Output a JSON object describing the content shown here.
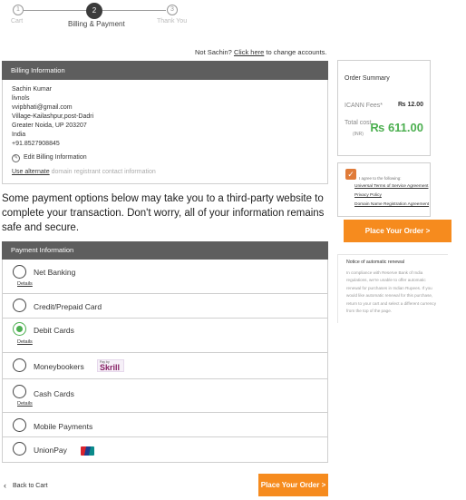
{
  "steps": [
    {
      "number": "1",
      "label": "Cart"
    },
    {
      "number": "2",
      "label": "Billing & Payment"
    },
    {
      "number": "3",
      "label": "Thank You"
    }
  ],
  "account_note": {
    "prefix": "Not Sachin?",
    "link": "Click here",
    "suffix": "to change accounts."
  },
  "billing": {
    "header": "Billing Information",
    "lines": [
      "Sachin Kumar",
      "livnols",
      "vvipbhati@gmail.com",
      "Village-Kailashpur,post-Dadri",
      "Greater Noida, UP  203207",
      "India",
      "+91.8527908845"
    ],
    "edit_label": "Edit Billing Information",
    "use_alternate": "Use alternate",
    "alternate_rest": "domain registrant contact information"
  },
  "payment_note": "Some payment options below may take you to a third-party website to complete your transaction. Don't worry, all of your information remains safe and secure.",
  "payment": {
    "header": "Payment Information",
    "details_label": "Details",
    "skrill_small": "Pay by",
    "skrill_brand": "Skrill",
    "options": [
      {
        "label": "Net Banking",
        "selected": false,
        "details": true
      },
      {
        "label": "Credit/Prepaid Card",
        "selected": false,
        "details": false
      },
      {
        "label": "Debit Cards",
        "selected": true,
        "details": true
      },
      {
        "label": "Moneybookers",
        "selected": false,
        "details": false
      },
      {
        "label": "Cash Cards",
        "selected": false,
        "details": true
      },
      {
        "label": "Mobile Payments",
        "selected": false,
        "details": false
      },
      {
        "label": "UnionPay",
        "selected": false,
        "details": false
      }
    ]
  },
  "footer": {
    "back_label": "Back to Cart",
    "back_icon": "chevron-left-icon",
    "place_order": "Place Your Order >"
  },
  "summary": {
    "title": "Order Summary",
    "icann_label": "ICANN Fees*",
    "icann_value": "₨ 12.00",
    "total_label": "Total cost",
    "total_sub": "(INR)",
    "total_value": "₨ 611.00"
  },
  "agreement": {
    "checked": true,
    "text": "I agree to the following:",
    "links": [
      "Universal Terms of Service Agreement",
      "Privacy Policy",
      "Domain Name Registration Agreement"
    ]
  },
  "place_order_side": "Place Your Order >",
  "renewal": {
    "title": "Notice of automatic renewal",
    "text": "In compliance with Reserve Bank of India regulations, we're unable to offer automatic renewal for purchases in Indian Rupees. If you would like automatic renewal for this purchase, return to your cart and select a different currency from the top of the page."
  },
  "colors": {
    "accent": "#f68b1e",
    "success": "#4caf50",
    "header": "#5e5e5e",
    "skrill": "#862165"
  }
}
